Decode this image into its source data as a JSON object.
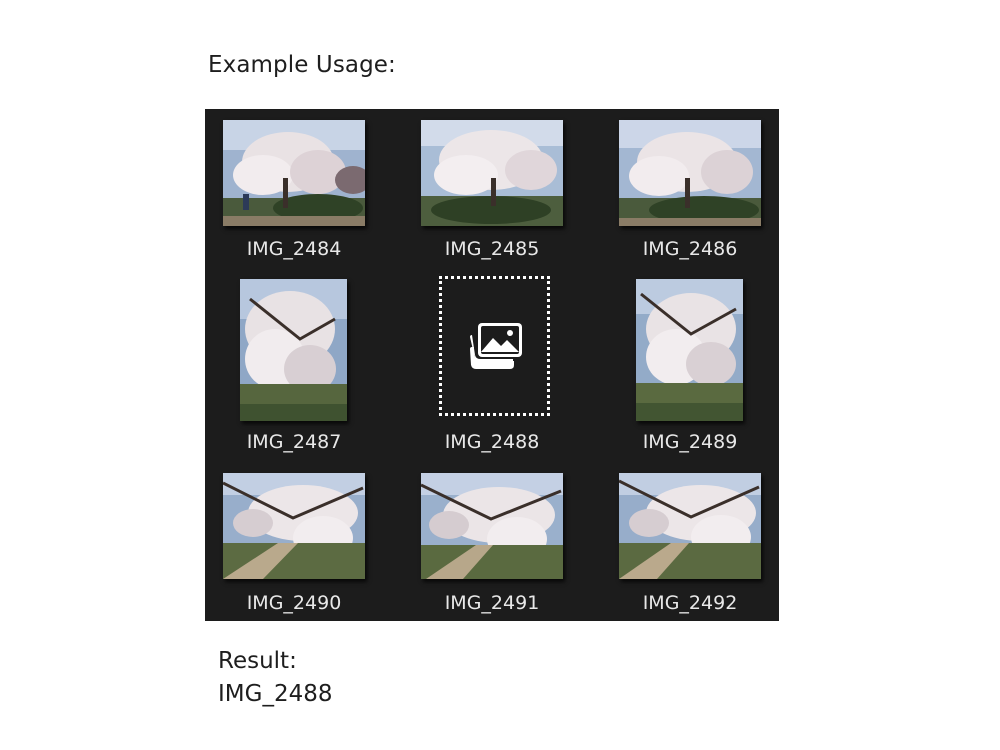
{
  "heading": "Example Usage:",
  "gallery": {
    "items": [
      {
        "label": "IMG_2484",
        "orientation": "landscape",
        "state": "loaded"
      },
      {
        "label": "IMG_2485",
        "orientation": "landscape",
        "state": "loaded"
      },
      {
        "label": "IMG_2486",
        "orientation": "landscape",
        "state": "loaded"
      },
      {
        "label": "IMG_2487",
        "orientation": "portrait",
        "state": "loaded"
      },
      {
        "label": "IMG_2488",
        "orientation": "placeholder",
        "state": "focused-placeholder",
        "icon": "photos-icon"
      },
      {
        "label": "IMG_2489",
        "orientation": "portrait",
        "state": "loaded"
      },
      {
        "label": "IMG_2490",
        "orientation": "landscape",
        "state": "loaded"
      },
      {
        "label": "IMG_2491",
        "orientation": "landscape",
        "state": "loaded"
      },
      {
        "label": "IMG_2492",
        "orientation": "landscape",
        "state": "loaded"
      }
    ],
    "background": "#1c1c1c"
  },
  "result": {
    "label": "Result:",
    "value": "IMG_2488"
  }
}
